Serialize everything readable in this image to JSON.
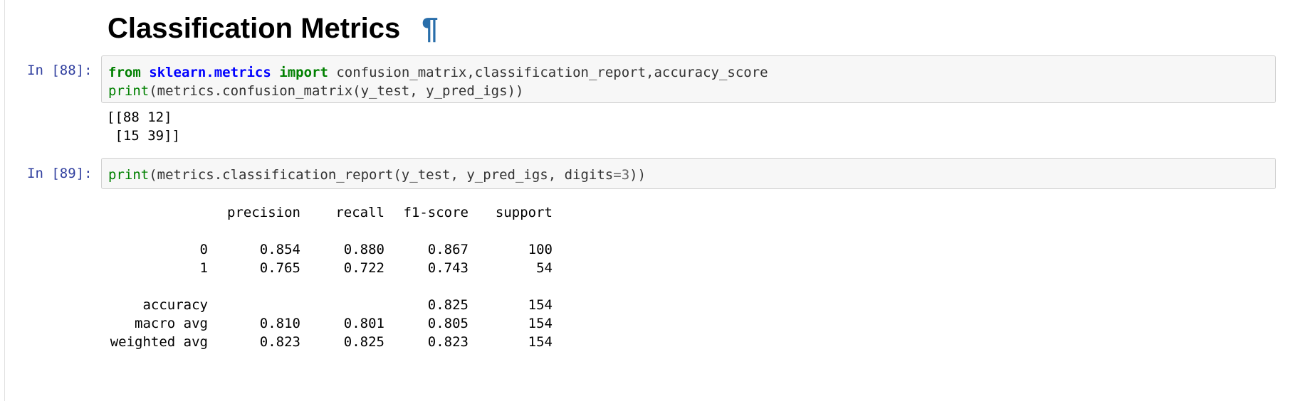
{
  "heading": {
    "title": "Classification Metrics",
    "anchor": "¶"
  },
  "cells": [
    {
      "prompt": "In [88]:",
      "code_lines": [
        [
          {
            "t": "from",
            "c": "kw"
          },
          {
            "t": " ",
            "c": ""
          },
          {
            "t": "sklearn.metrics",
            "c": "mod"
          },
          {
            "t": " ",
            "c": ""
          },
          {
            "t": "import",
            "c": "kw"
          },
          {
            "t": " confusion_matrix,classification_report,accuracy_score",
            "c": ""
          }
        ],
        [
          {
            "t": "print",
            "c": "bi"
          },
          {
            "t": "(metrics.confusion_matrix(y_test, y_pred_igs))",
            "c": ""
          }
        ]
      ],
      "output_lines": [
        "[[88 12]",
        " [15 39]]"
      ]
    },
    {
      "prompt": "In [89]:",
      "code_lines": [
        [
          {
            "t": "print",
            "c": "bi"
          },
          {
            "t": "(metrics.classification_report(y_test, y_pred_igs, digits",
            "c": ""
          },
          {
            "t": "=",
            "c": "op"
          },
          {
            "t": "3",
            "c": "num"
          },
          {
            "t": "))",
            "c": ""
          }
        ]
      ]
    }
  ],
  "report": {
    "headers": [
      "",
      "precision",
      "recall",
      "f1-score",
      "support"
    ],
    "rows": [
      [
        "",
        "",
        "",
        "",
        ""
      ],
      [
        "0",
        "0.854",
        "0.880",
        "0.867",
        "100"
      ],
      [
        "1",
        "0.765",
        "0.722",
        "0.743",
        "54"
      ],
      [
        "",
        "",
        "",
        "",
        ""
      ],
      [
        "accuracy",
        "",
        "",
        "0.825",
        "154"
      ],
      [
        "macro avg",
        "0.810",
        "0.801",
        "0.805",
        "154"
      ],
      [
        "weighted avg",
        "0.823",
        "0.825",
        "0.823",
        "154"
      ]
    ]
  }
}
